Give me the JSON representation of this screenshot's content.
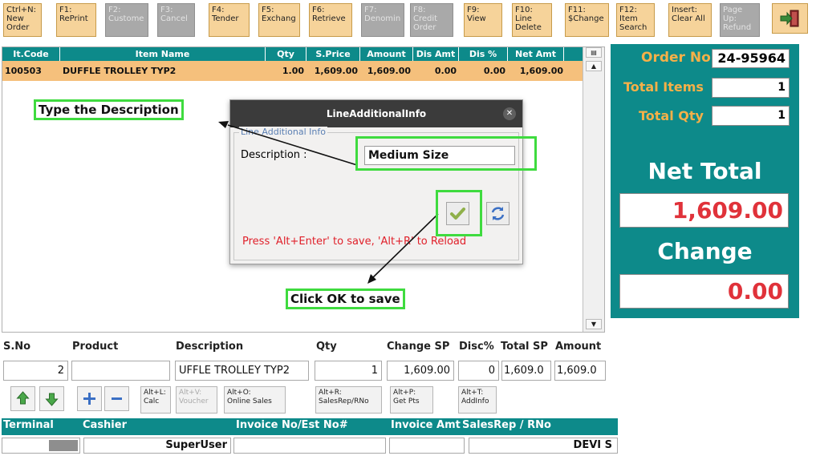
{
  "toolbar": {
    "keys": [
      {
        "label": "Ctrl+N:\nNew\nOrder",
        "enabled": true
      },
      {
        "label": "F1:\nRePrint",
        "enabled": true
      },
      {
        "label": "F2:\nCustome",
        "enabled": false
      },
      {
        "label": "F3:\nCancel",
        "enabled": false
      },
      {
        "label": "F4:\nTender",
        "enabled": true
      },
      {
        "label": "F5:\nExchang",
        "enabled": true
      },
      {
        "label": "F6:\nRetrieve",
        "enabled": true
      },
      {
        "label": "F7:\nDenomin",
        "enabled": false
      },
      {
        "label": "F8:\nCredit\nOrder",
        "enabled": false
      },
      {
        "label": "F9:\nView",
        "enabled": true
      },
      {
        "label": "F10:\nLine\nDelete",
        "enabled": true
      },
      {
        "label": "F11:\n$Change",
        "enabled": true
      },
      {
        "label": "F12:\nItem\nSearch",
        "enabled": true
      },
      {
        "label": "Insert:\nClear All",
        "enabled": true
      },
      {
        "label": "Page\nUp:\nRefund",
        "enabled": false
      }
    ],
    "exit_icon": "exit-door-icon"
  },
  "grid": {
    "columns": [
      "It.Code",
      "Item Name",
      "Qty",
      "S.Price",
      "Amount",
      "Dis Amt",
      "Dis %",
      "Net Amt"
    ],
    "rows": [
      {
        "code": "100503",
        "name": "DUFFLE TROLLEY TYP2",
        "qty": "1.00",
        "sprice": "1,609.00",
        "amount": "1,609.00",
        "disamt": "0.00",
        "disper": "0.00",
        "netamt": "1,609.00"
      }
    ]
  },
  "summary": {
    "order_no_label": "Order No",
    "order_no": "24-95964",
    "total_items_label": "Total Items",
    "total_items": "1",
    "total_qty_label": "Total Qty",
    "total_qty": "1",
    "net_total_label": "Net Total",
    "net_total": "1,609.00",
    "change_label": "Change",
    "change": "0.00"
  },
  "dialog": {
    "title": "LineAdditionalInfo",
    "legend": "Line Additional Info",
    "description_label": "Description :",
    "description_value": "Medium Size",
    "hint": "Press 'Alt+Enter' to save, 'Alt+R' to Reload"
  },
  "annotations": {
    "type_description": "Type the Description",
    "click_ok": "Click OK to save"
  },
  "line_entry": {
    "headers": {
      "sno": "S.No",
      "product": "Product",
      "description": "Description",
      "qty": "Qty",
      "change_sp": "Change SP",
      "disc": "Disc%",
      "total_sp": "Total SP",
      "amount": "Amount"
    },
    "values": {
      "sno": "2",
      "product": "",
      "description": "UFFLE TROLLEY TYP2",
      "qty": "1",
      "change_sp": "1,609.00",
      "disc": "0",
      "total_sp": "1,609.0",
      "amount": "1,609.0"
    },
    "buttons": {
      "calc": "Alt+L:\nCalc",
      "voucher": "Alt+V:\nVoucher",
      "online_sales": "Alt+O:\nOnline Sales",
      "salesrep": "Alt+R:\nSalesRep/RNo",
      "get_pts": "Alt+P:\nGet Pts",
      "addinfo": "Alt+T:\nAddInfo"
    }
  },
  "footer": {
    "headers": {
      "terminal": "Terminal",
      "cashier": "Cashier",
      "invoice_no": "Invoice No/Est No#",
      "invoice_amt": "Invoice Amt",
      "salesrep": "SalesRep / RNo"
    },
    "values": {
      "cashier": "SuperUser",
      "salesrep": "DEVI S"
    }
  },
  "colors": {
    "teal": "#0d8a8a",
    "accent_orange": "#f5b048",
    "amount_red": "#e0323a",
    "highlight_green": "#3fdb3f",
    "row_highlight": "#f5c07c"
  }
}
